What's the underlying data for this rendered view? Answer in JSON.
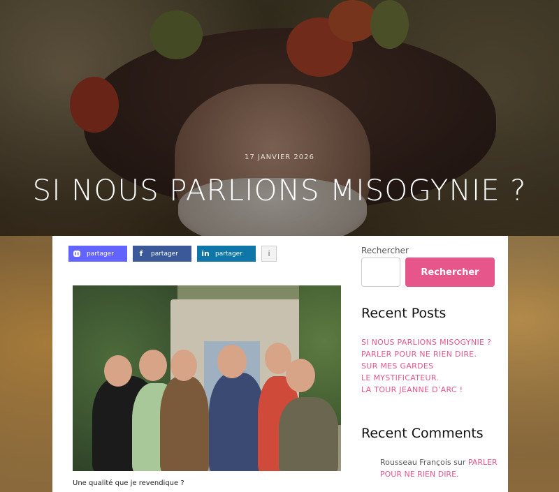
{
  "hero": {
    "date": "17 JANVIER 2026",
    "title": "SI NOUS PARLIONS MISOGYNIE ?"
  },
  "share": {
    "mastodon_label": "partager",
    "facebook_label": "partager",
    "linkedin_label": "partager",
    "info_label": "i"
  },
  "article": {
    "caption": "Une qualité que je revendique ?"
  },
  "sidebar": {
    "search_label": "Rechercher",
    "search_button": "Rechercher",
    "recent_posts_title": "Recent Posts",
    "recent_posts": [
      "SI NOUS PARLIONS MISOGYNIE ?",
      "PARLER POUR NE RIEN DIRE.",
      "SUR MES GARDES",
      "LE MYSTIFICATEUR.",
      "LA TOUR JEANNE D’ARC !"
    ],
    "recent_comments_title": "Recent Comments",
    "comment": {
      "author": "Rousseau François",
      "sur": "sur",
      "post": "PARLER POUR NE RIEN DIRE."
    }
  },
  "colors": {
    "accent": "#e6568a",
    "mastodon": "#6364ff",
    "facebook": "#3b5998",
    "linkedin": "#0e76a8"
  },
  "icons": [
    "mastodon-icon",
    "facebook-icon",
    "linkedin-icon",
    "info-icon"
  ]
}
